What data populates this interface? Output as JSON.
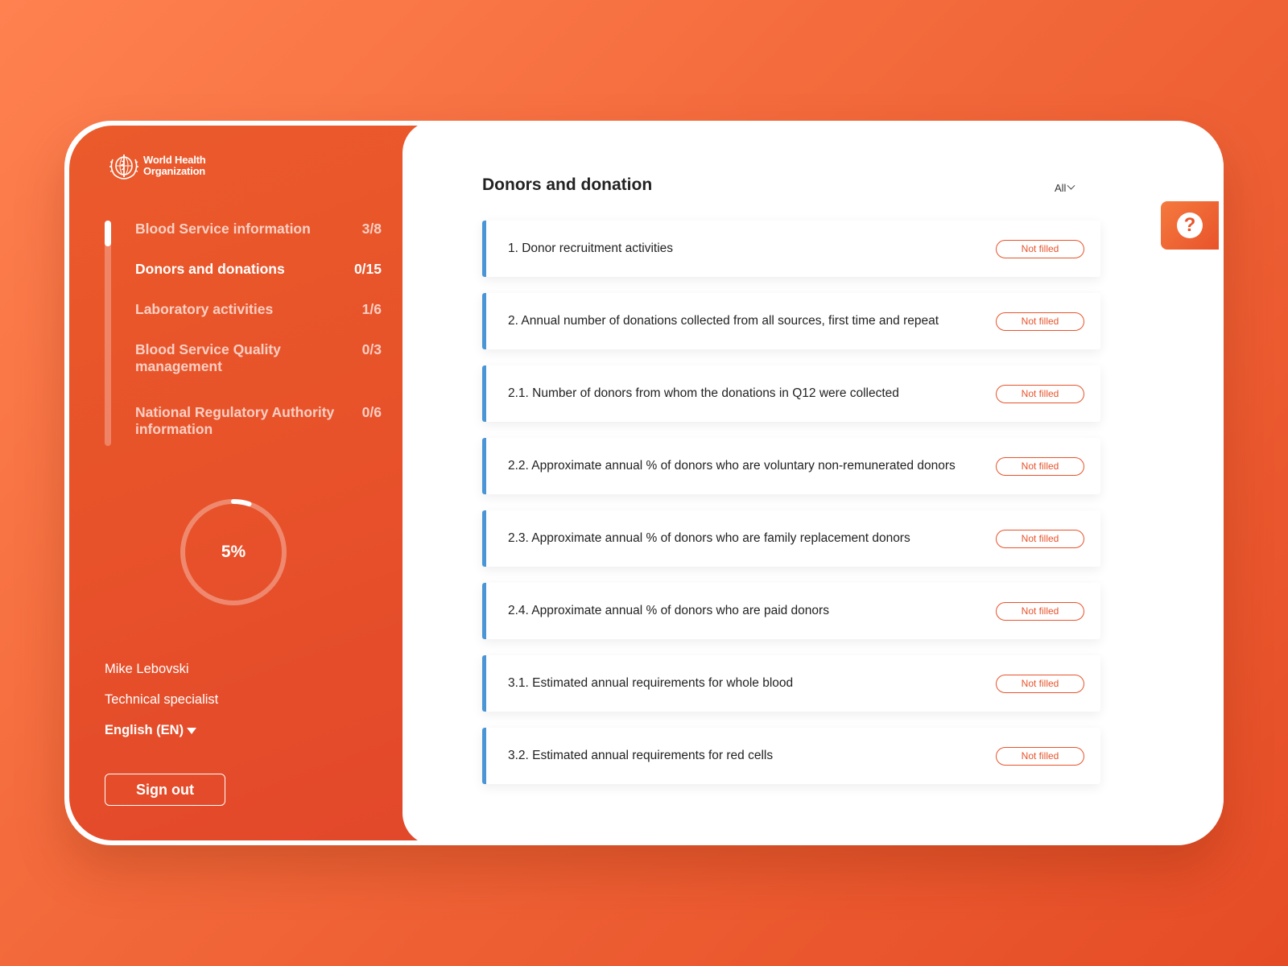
{
  "logo": {
    "line1": "World Health",
    "line2": "Organization",
    "icon": "who-emblem-icon"
  },
  "nav": [
    {
      "label": "Blood Service information",
      "count": "3/8"
    },
    {
      "label": "Donors and donations",
      "count": "0/15"
    },
    {
      "label": "Laboratory activities",
      "count": "1/6"
    },
    {
      "label": "Blood Service Quality management",
      "count": "0/3"
    },
    {
      "label": "National Regulatory Authority information",
      "count": "0/6"
    }
  ],
  "progress": {
    "value": 0.05,
    "label": "5%"
  },
  "user": {
    "name": "Mike Lebovski",
    "role": "Technical specialist",
    "language": "English (EN)"
  },
  "signout_label": "Sign out",
  "main": {
    "title": "Donors and donation",
    "filter": "All",
    "status_label": "Not filled",
    "items": [
      {
        "label": "1. Donor recruitment activities",
        "status": "Not filled"
      },
      {
        "label": "2. Annual number of donations collected from all sources, first time and repeat",
        "status": "Not filled"
      },
      {
        "label": "2.1. Number of donors from whom the donations in Q12 were collected",
        "status": "Not filled"
      },
      {
        "label": "2.2. Approximate annual % of donors who are voluntary non-remunerated donors",
        "status": "Not filled"
      },
      {
        "label": "2.3. Approximate annual % of donors who are family replacement donors",
        "status": "Not filled"
      },
      {
        "label": "2.4. Approximate annual % of donors who are paid donors",
        "status": "Not filled"
      },
      {
        "label": "3.1. Estimated annual requirements for whole blood",
        "status": "Not filled"
      },
      {
        "label": "3.2. Estimated annual requirements for red cells",
        "status": "Not filled"
      }
    ]
  },
  "help": {
    "symbol": "?",
    "icon": "help-question-icon"
  },
  "colors": {
    "accent": "#e8532b",
    "row_border": "#4a95d6",
    "sidebar": "#e8522a"
  }
}
